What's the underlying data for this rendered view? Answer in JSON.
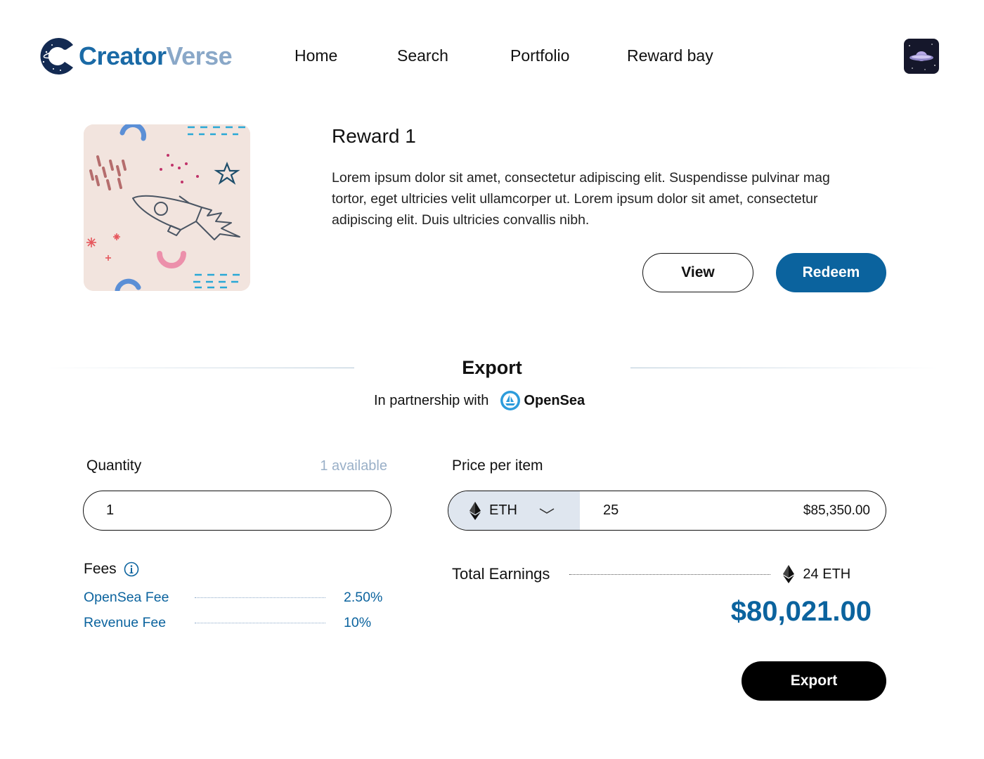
{
  "brand": {
    "name_part1": "Creator",
    "name_part2": "Verse"
  },
  "nav": {
    "items": [
      "Home",
      "Search",
      "Portfolio",
      "Reward bay"
    ]
  },
  "reward": {
    "title": "Reward 1",
    "description": "Lorem ipsum dolor sit amet, consectetur adipiscing elit. Suspendisse pulvinar mag\ntortor, eget ultricies velit ullamcorper ut. Lorem ipsum dolor sit amet, consectetur\nadipiscing elit. Duis ultricies convallis nibh.",
    "view_label": "View",
    "redeem_label": "Redeem"
  },
  "export": {
    "title": "Export",
    "partner_text": "In partnership with",
    "partner_name": "OpenSea",
    "quantity_label": "Quantity",
    "available": "1 available",
    "quantity_value": "1",
    "price_label": "Price per item",
    "currency": "ETH",
    "price_value": "25",
    "price_usd": "$85,350.00",
    "fees_label": "Fees",
    "fees": [
      {
        "name": "OpenSea Fee",
        "value": "2.50%"
      },
      {
        "name": "Revenue Fee",
        "value": "10%"
      }
    ],
    "total_label": "Total Earnings",
    "total_eth": "24 ETH",
    "total_usd": "$80,021.00",
    "export_button": "Export"
  },
  "colors": {
    "brand_blue": "#0b639e",
    "logo_light": "#8aa8c8",
    "currency_bg": "#dfe6ef"
  }
}
